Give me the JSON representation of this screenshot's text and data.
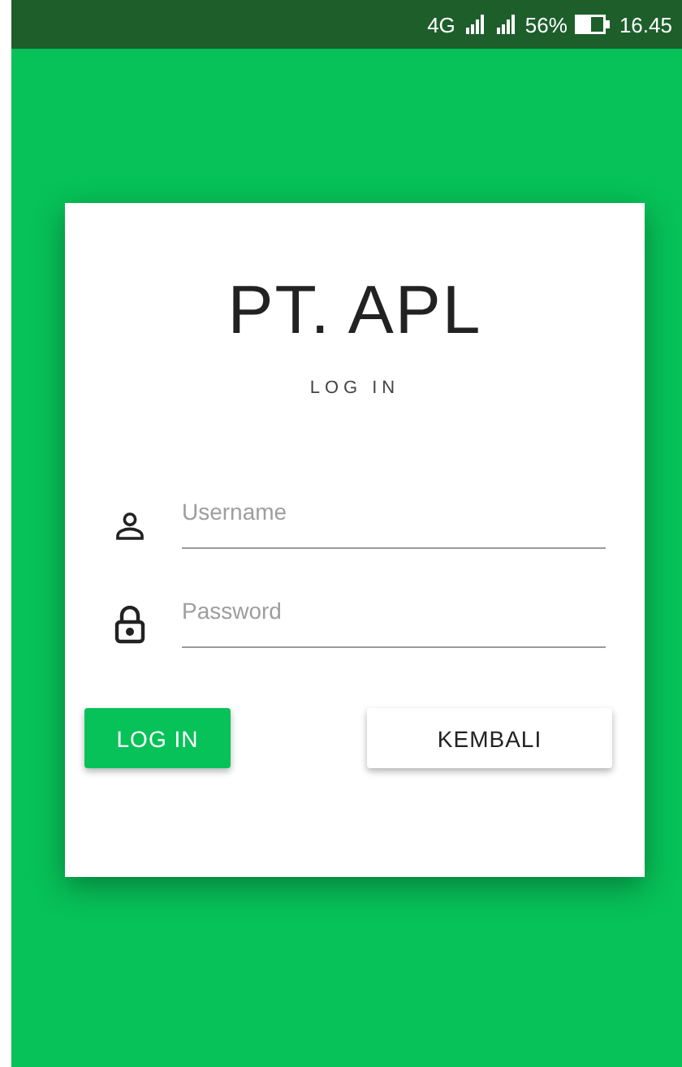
{
  "status_bar": {
    "network": "4G",
    "battery": "56%",
    "time": "16.45"
  },
  "card": {
    "title": "PT. APL",
    "subtitle": "LOG IN",
    "fields": [
      {
        "kind": "user",
        "placeholder": "Username"
      },
      {
        "kind": "lock",
        "placeholder": "Password"
      }
    ],
    "buttons": [
      {
        "label": "LOG IN",
        "kind": "primary"
      },
      {
        "label": "KEMBALI",
        "kind": "secondary"
      }
    ]
  }
}
